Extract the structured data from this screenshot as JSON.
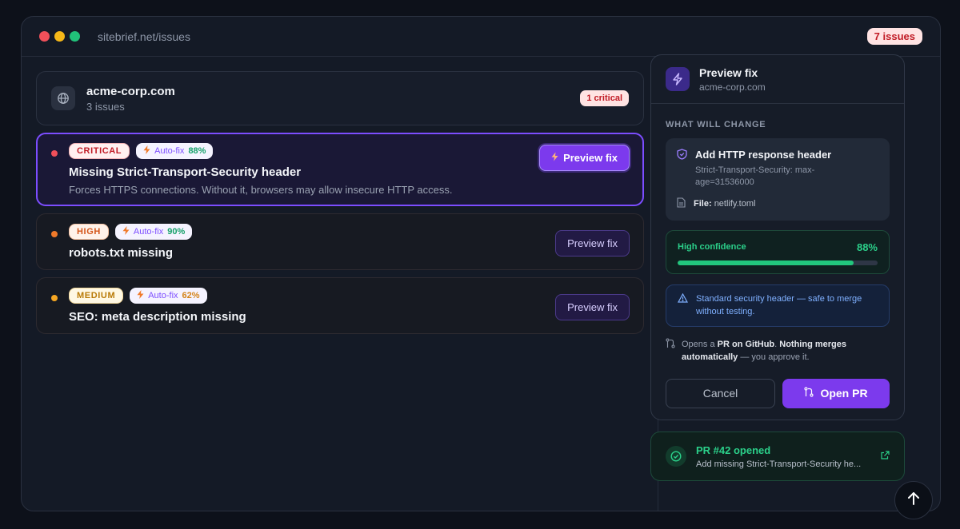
{
  "window": {
    "url": "sitebrief.net/issues",
    "issues_count": "7 issues"
  },
  "site": {
    "name": "acme-corp.com",
    "sub": "3 issues",
    "critical": "1 critical"
  },
  "issues": [
    {
      "severity": "CRITICAL",
      "autofix_label": "Auto-fix",
      "autofix_pct": "88%",
      "title": "Missing Strict-Transport-Security header",
      "desc": "Forces HTTPS connections. Without it, browsers may allow insecure HTTP access.",
      "button": "Preview fix",
      "selected": true,
      "dot_color": "#f0505a",
      "pct_color": "#16a06a"
    },
    {
      "severity": "HIGH",
      "autofix_label": "Auto-fix",
      "autofix_pct": "90%",
      "title": "robots.txt missing",
      "desc": "",
      "button": "Preview fix",
      "selected": false,
      "dot_color": "#f07a2a",
      "pct_color": "#16a06a"
    },
    {
      "severity": "MEDIUM",
      "autofix_label": "Auto-fix",
      "autofix_pct": "62%",
      "title": "SEO: meta description missing",
      "desc": "",
      "button": "Preview fix",
      "selected": false,
      "dot_color": "#f5a623",
      "pct_color": "#d4841a"
    }
  ],
  "panel": {
    "title": "Preview fix",
    "subtitle": "acme-corp.com",
    "section": "WHAT WILL CHANGE",
    "change_title": "Add HTTP response header",
    "change_detail": "Strict-Transport-Security: max-age=31536000",
    "file_label": "File:",
    "file_name": "netlify.toml",
    "confidence_label": "High confidence",
    "confidence_value": "88%",
    "confidence_fraction": 0.88,
    "note": "Standard security header — safe to merge without testing.",
    "pr_opens": "Opens a ",
    "pr_github": "PR on GitHub",
    "pr_mid": ". ",
    "pr_nothing": "Nothing merges automatically",
    "pr_end": " — you approve it.",
    "cancel": "Cancel",
    "open_pr": "Open PR"
  },
  "toast": {
    "title": "PR #42 opened",
    "sub": "Add missing Strict-Transport-Security he..."
  },
  "colors": {
    "accent": "#7c3aed",
    "success": "#22c77d",
    "critical": "#c01a24"
  }
}
